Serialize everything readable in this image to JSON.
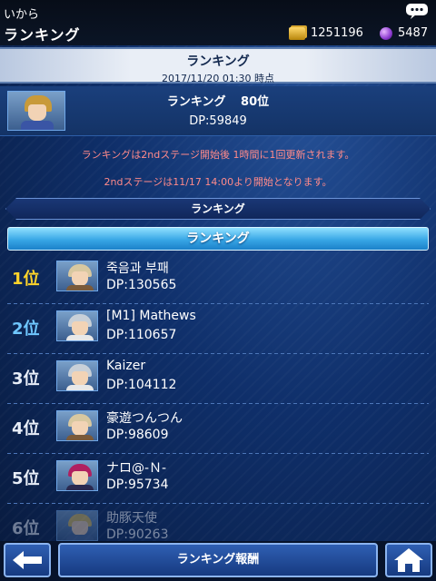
{
  "topbar": {
    "small_title": "いから",
    "title": "ランキング",
    "gold_amount": "1251196",
    "gem_amount": "5487",
    "icons": [
      "chat-icon",
      "gold-icon",
      "gem-icon"
    ]
  },
  "header": {
    "title": "ランキング",
    "datetime": "2017/11/20 01:30 時点"
  },
  "my_rank": {
    "label": "ランキング",
    "rank": "80位",
    "dp": "DP:59849"
  },
  "notices": [
    "ランキングは2ndステージ開始後 1時間に1回更新されます。",
    "2ndステージは11/17 14:00より開始となります。"
  ],
  "section_tab": "ランキング",
  "subheader": "ランキング",
  "rankings": [
    {
      "rank": "1位",
      "name": "죽음과 부패",
      "dp": "DP:130565",
      "rank_color": "#ffd42a"
    },
    {
      "rank": "2位",
      "name": "[M1] Mathews",
      "dp": "DP:110657",
      "rank_color": "#6fc7ff"
    },
    {
      "rank": "3位",
      "name": "Kaizer",
      "dp": "DP:104112",
      "rank_color": "#e8eef8"
    },
    {
      "rank": "4位",
      "name": "豪遊つんつん",
      "dp": "DP:98609",
      "rank_color": "#e8eef8"
    },
    {
      "rank": "5位",
      "name": "ナロ@-Ｎ-",
      "dp": "DP:95734",
      "rank_color": "#e8eef8"
    },
    {
      "rank": "6位",
      "name": "助豚天使",
      "dp": "DP:90263",
      "rank_color": "#e8eef8"
    }
  ],
  "bottom_nav": {
    "reward_label": "ランキング報酬",
    "icons": [
      "back-arrow-icon",
      "home-icon"
    ]
  },
  "colors": {
    "accent_blue": "#38a7e6",
    "notice_red": "#ff8a8a",
    "gold": "#ffd42a"
  }
}
